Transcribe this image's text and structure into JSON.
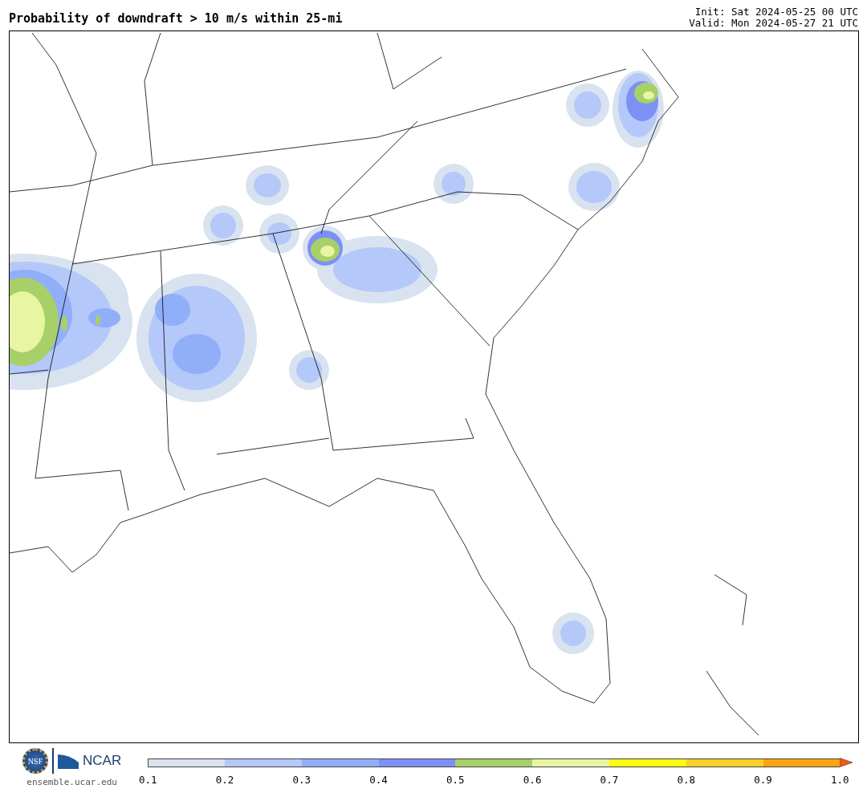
{
  "title": "Probability of downdraft > 10 m/s within 25-mi",
  "init": "Init: Sat 2024-05-25 00 UTC",
  "valid": "Valid: Mon 2024-05-27 21 UTC",
  "logo": {
    "left": "NSF",
    "right": "NCAR"
  },
  "site": "ensemble.ucar.edu",
  "colorbar": {
    "bins": [
      {
        "color": "#d8e3ef"
      },
      {
        "color": "#b4c8fa"
      },
      {
        "color": "#91aef9"
      },
      {
        "color": "#7d90f5"
      },
      {
        "color": "#a8d068"
      },
      {
        "color": "#e8f6a4"
      },
      {
        "color": "#fafa14"
      },
      {
        "color": "#fcd028"
      },
      {
        "color": "#fca414"
      },
      {
        "color": "#f25a0a",
        "kind": "arrow"
      }
    ],
    "ticks": [
      "0.1",
      "0.2",
      "0.3",
      "0.4",
      "0.5",
      "0.6",
      "0.7",
      "0.8",
      "0.9",
      "1.0"
    ]
  }
}
